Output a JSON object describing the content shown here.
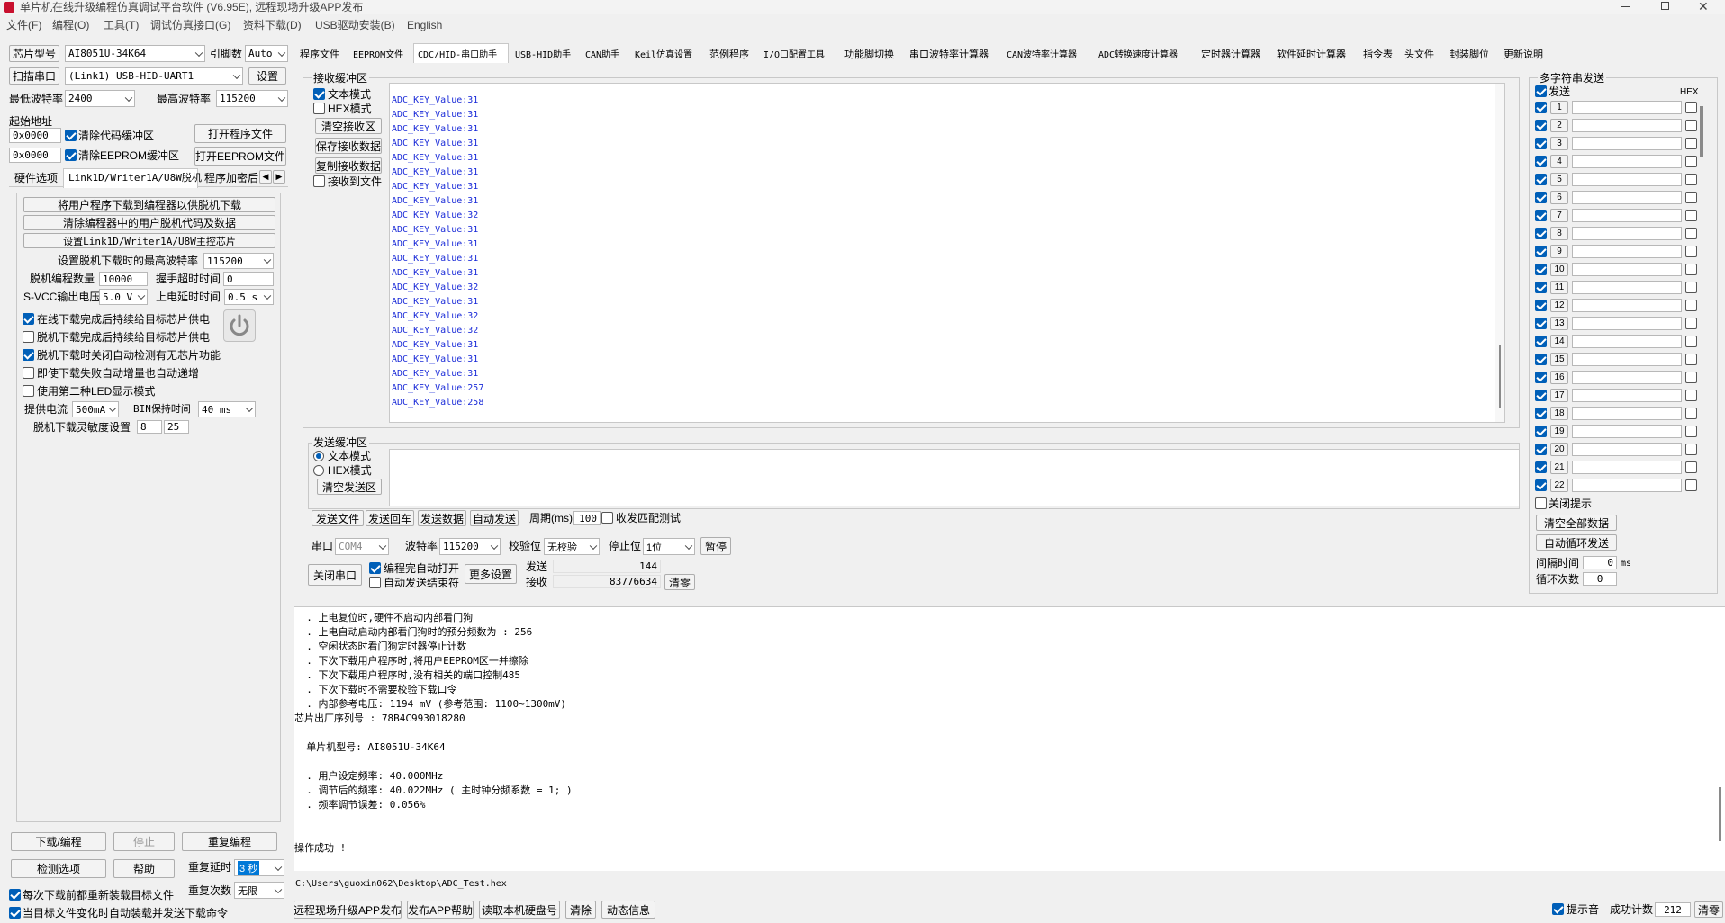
{
  "window": {
    "title": "单片机在线升级编程仿真调试平台软件 (V6.95E), 远程现场升级APP发布",
    "menu": [
      "文件(F)",
      "编程(O)",
      "工具(T)",
      "调试仿真接口(G)",
      "资料下载(D)",
      "USB驱动安装(B)",
      "English"
    ]
  },
  "left": {
    "chip_label": "芯片型号",
    "chip_value": "AI8051U-34K64",
    "pin_label": "引脚数",
    "pin_value": "Auto",
    "scan_button": "扫描串口",
    "port_value": "(Link1) USB-HID-UART1",
    "settings_button": "设置",
    "min_baud_label": "最低波特率",
    "min_baud_value": "2400",
    "max_baud_label": "最高波特率",
    "max_baud_value": "115200",
    "start_addr_label": "起始地址",
    "addr1": "0x0000",
    "clear_code_label": "清除代码缓冲区",
    "open_program_button": "打开程序文件",
    "addr2": "0x0000",
    "clear_eeprom_label": "清除EEPROM缓冲区",
    "open_eeprom_button": "打开EEPROM文件",
    "subtabs": [
      "硬件选项",
      "Link1D/Writer1A/U8W脱机",
      "程序加密后"
    ],
    "offline": {
      "btn1": "将用户程序下载到编程器以供脱机下载",
      "btn2": "清除编程器中的用户脱机代码及数据",
      "btn3": "设置Link1D/Writer1A/U8W主控芯片",
      "max_baud_label": "设置脱机下载时的最高波特率",
      "max_baud_value": "115200",
      "count_label": "脱机编程数量",
      "count_value": "10000",
      "handshake_label": "握手超时时间",
      "handshake_value": "0",
      "svcc_label": "S-VCC输出电压",
      "svcc_value": "5.0 V",
      "power_delay_label": "上电延时时间",
      "power_delay_value": "0.5 s",
      "opt1": "在线下载完成后持续给目标芯片供电",
      "opt2": "脱机下载完成后持续给目标芯片供电",
      "opt3": "脱机下载时关闭自动检测有无芯片功能",
      "opt4": "即使下载失败自动增量也自动递增",
      "opt5": "使用第二种LED显示模式",
      "current_label": "提供电流",
      "current_value": "500mA",
      "bin_label": "BIN保持时间",
      "bin_value": "40 ms",
      "sensitivity_label": "脱机下载灵敏度设置",
      "sens1": "8",
      "sens2": "25"
    },
    "download_button": "下载/编程",
    "stop_button": "停止",
    "reprogram_button": "重复编程",
    "check_button": "检测选项",
    "help_button": "帮助",
    "repeat_delay_label": "重复延时",
    "repeat_delay_value": "3 秒",
    "repeat_count_label": "重复次数",
    "repeat_count_value": "无限",
    "reload_label": "每次下载前都重新装载目标文件",
    "auto_send_label": "当目标文件变化时自动装载并发送下载命令"
  },
  "tabs": [
    "程序文件",
    "EEPROM文件",
    "CDC/HID-串口助手",
    "USB-HID助手",
    "CAN助手",
    "Keil仿真设置",
    "范例程序",
    "I/O口配置工具",
    "功能脚切换",
    "串口波特率计算器",
    "CAN波特率计算器",
    "ADC转换速度计算器",
    "定时器计算器",
    "软件延时计算器",
    "指令表",
    "头文件",
    "封装脚位",
    "更新说明"
  ],
  "recv": {
    "group_label": "接收缓冲区",
    "text_mode": "文本模式",
    "hex_mode": "HEX模式",
    "clear_btn": "清空接收区",
    "save_btn": "保存接收数据",
    "copy_btn": "复制接收数据",
    "to_file": "接收到文件",
    "lines": [
      "ADC_KEY_Value:31",
      "ADC_KEY_Value:31",
      "ADC_KEY_Value:31",
      "ADC_KEY_Value:31",
      "ADC_KEY_Value:31",
      "ADC_KEY_Value:31",
      "ADC_KEY_Value:31",
      "ADC_KEY_Value:31",
      "ADC_KEY_Value:32",
      "ADC_KEY_Value:31",
      "ADC_KEY_Value:31",
      "ADC_KEY_Value:31",
      "ADC_KEY_Value:31",
      "ADC_KEY_Value:32",
      "ADC_KEY_Value:31",
      "ADC_KEY_Value:32",
      "ADC_KEY_Value:32",
      "ADC_KEY_Value:31",
      "ADC_KEY_Value:31",
      "ADC_KEY_Value:31",
      "ADC_KEY_Value:257",
      "ADC_KEY_Value:258"
    ]
  },
  "send": {
    "group_label": "发送缓冲区",
    "text_mode": "文本模式",
    "hex_mode": "HEX模式",
    "clear_btn": "清空发送区",
    "send_file": "发送文件",
    "send_enter": "发送回车",
    "send_data": "发送数据",
    "auto_send": "自动发送",
    "period_label": "周期(ms)",
    "period_value": "100",
    "match_test": "收发匹配测试"
  },
  "port": {
    "port_label": "串口",
    "port_value": "COM4",
    "baud_label": "波特率",
    "baud_value": "115200",
    "parity_label": "校验位",
    "parity_value": "无校验",
    "stop_label": "停止位",
    "stop_value": "1位",
    "pause_btn": "暂停",
    "close_btn": "关闭串口",
    "auto_open": "编程完自动打开",
    "auto_end": "自动发送结束符",
    "more_btn": "更多设置",
    "sent_label": "发送",
    "sent_value": "144",
    "recv_label": "接收",
    "recv_value": "83776634",
    "clear_btn": "清零"
  },
  "multi": {
    "title": "多字符串发送",
    "send_label": "发送",
    "hex_label": "HEX",
    "rows": [
      "1",
      "2",
      "3",
      "4",
      "5",
      "6",
      "7",
      "8",
      "9",
      "10",
      "11",
      "12",
      "13",
      "14",
      "15",
      "16",
      "17",
      "18",
      "19",
      "20",
      "21",
      "22"
    ],
    "close_tip": "关闭提示",
    "clear_all": "清空全部数据",
    "auto_loop": "自动循环发送",
    "interval_label": "间隔时间",
    "interval_value": "0",
    "interval_unit": "ms",
    "loop_label": "循环次数",
    "loop_value": "0"
  },
  "log": {
    "lines": [
      "  . 上电复位时,硬件不启动内部看门狗",
      "  . 上电自动启动内部看门狗时的预分频数为 : 256",
      "  . 空闲状态时看门狗定时器停止计数",
      "  . 下次下载用户程序时,将用户EEPROM区一并擦除",
      "  . 下次下载用户程序时,没有相关的端口控制485",
      "  . 下次下载时不需要校验下载口令",
      "  . 内部参考电压: 1194 mV (参考范围: 1100~1300mV)",
      "芯片出厂序列号 : 78B4C993018280",
      "",
      "  单片机型号: AI8051U-34K64",
      "",
      "  . 用户设定频率: 40.000MHz",
      "  . 调节后的频率: 40.022MHz ( 主时钟分频系数 = 1; )",
      "  . 频率调节误差: 0.056%",
      "",
      "",
      "操作成功 !"
    ]
  },
  "status": {
    "file_path": "C:\\Users\\guoxin062\\Desktop\\ADC_Test.hex",
    "btn_publish": "远程现场升级APP发布",
    "btn_help": "发布APP帮助",
    "btn_usb": "读取本机硬盘号",
    "btn_clear": "清除",
    "btn_dynamic": "动态信息",
    "beep_label": "提示音",
    "success_label": "成功计数",
    "success_value": "212",
    "clear_btn": "清零"
  }
}
